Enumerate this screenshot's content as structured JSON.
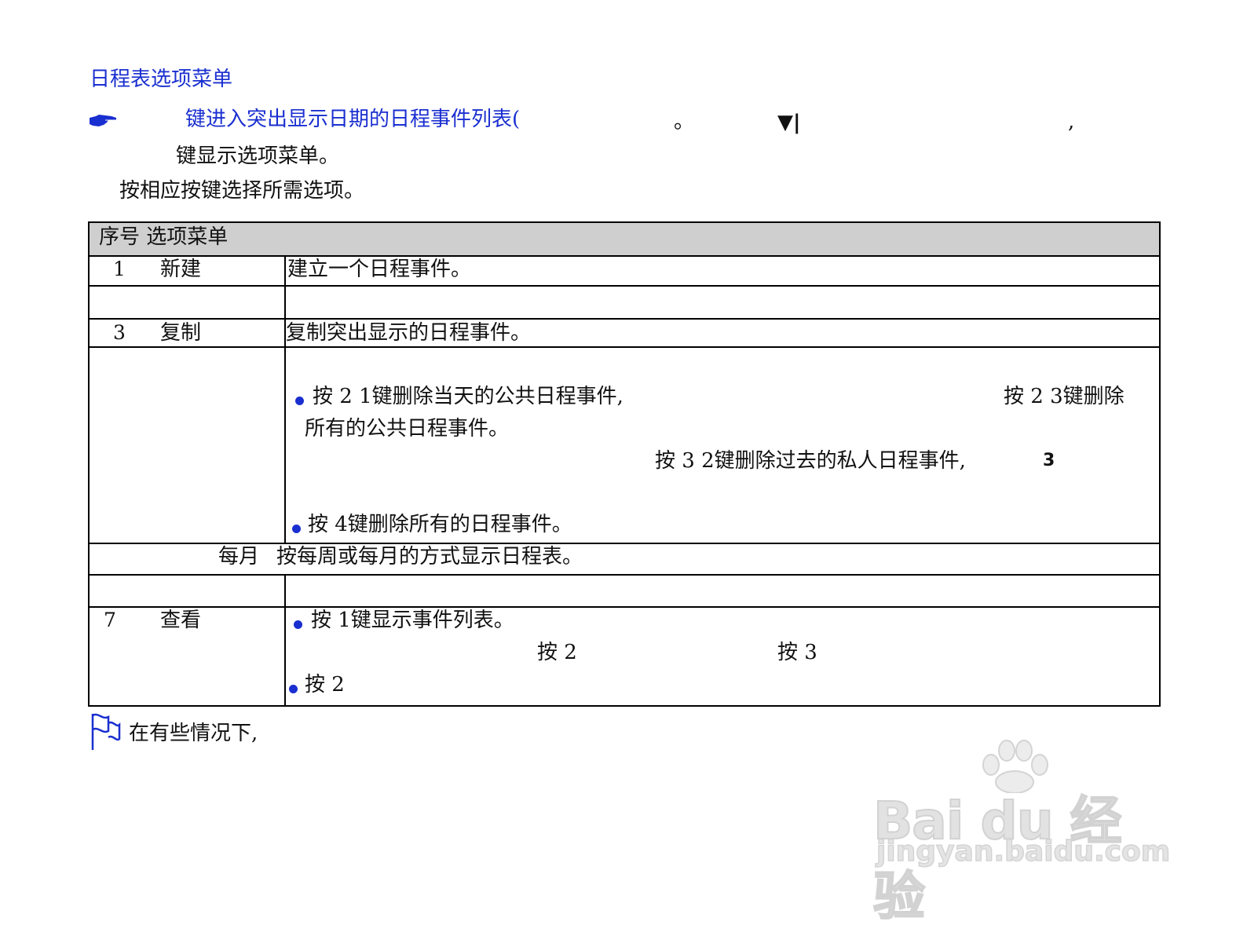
{
  "heading": "日程表选项菜单",
  "intro": {
    "line1": "键进入突出显示日期的日程事件列表(",
    "dot1": "。",
    "arrow_glyph": "▼|",
    "comma1": ",",
    "line2": "键显示选项菜单。",
    "line3": "按相应按键选择所需选项。"
  },
  "table": {
    "header": "序号 选项菜单",
    "row1": {
      "num": "1",
      "name": "新建",
      "desc": "建立一个日程事件。"
    },
    "row3": {
      "num": "3",
      "name": "复制",
      "desc": "复制突出显示的日程事件。"
    },
    "row4": {
      "bullet1_a": "按 2  1键删除当天的公共日程事件,",
      "bullet1_b": "按 2  3键删除",
      "bullet1_c": "所有的公共日程事件。",
      "line2_a": "按 3  2键删除过去的私人日程事件,",
      "line2_b": "3",
      "bullet2": "按 4键删除所有的日程事件。"
    },
    "row5": {
      "name": "每月",
      "desc": "按每周或每月的方式显示日程表。"
    },
    "row7": {
      "num": "7",
      "name": "查看",
      "bullet1": "按  1键显示事件列表。",
      "line2_a": "按 2",
      "line2_b": "按 3",
      "bullet2": "按 2"
    }
  },
  "note": "在有些情况下,",
  "watermark": {
    "logo": "Bai du 经验",
    "url": "jingyan.baidu.com"
  },
  "icons": {
    "pointer": "pointing-hand-icon",
    "note": "flag-note-icon"
  },
  "colors": {
    "accent": "#1a2fd0",
    "header_bg": "#cfcfcf"
  }
}
